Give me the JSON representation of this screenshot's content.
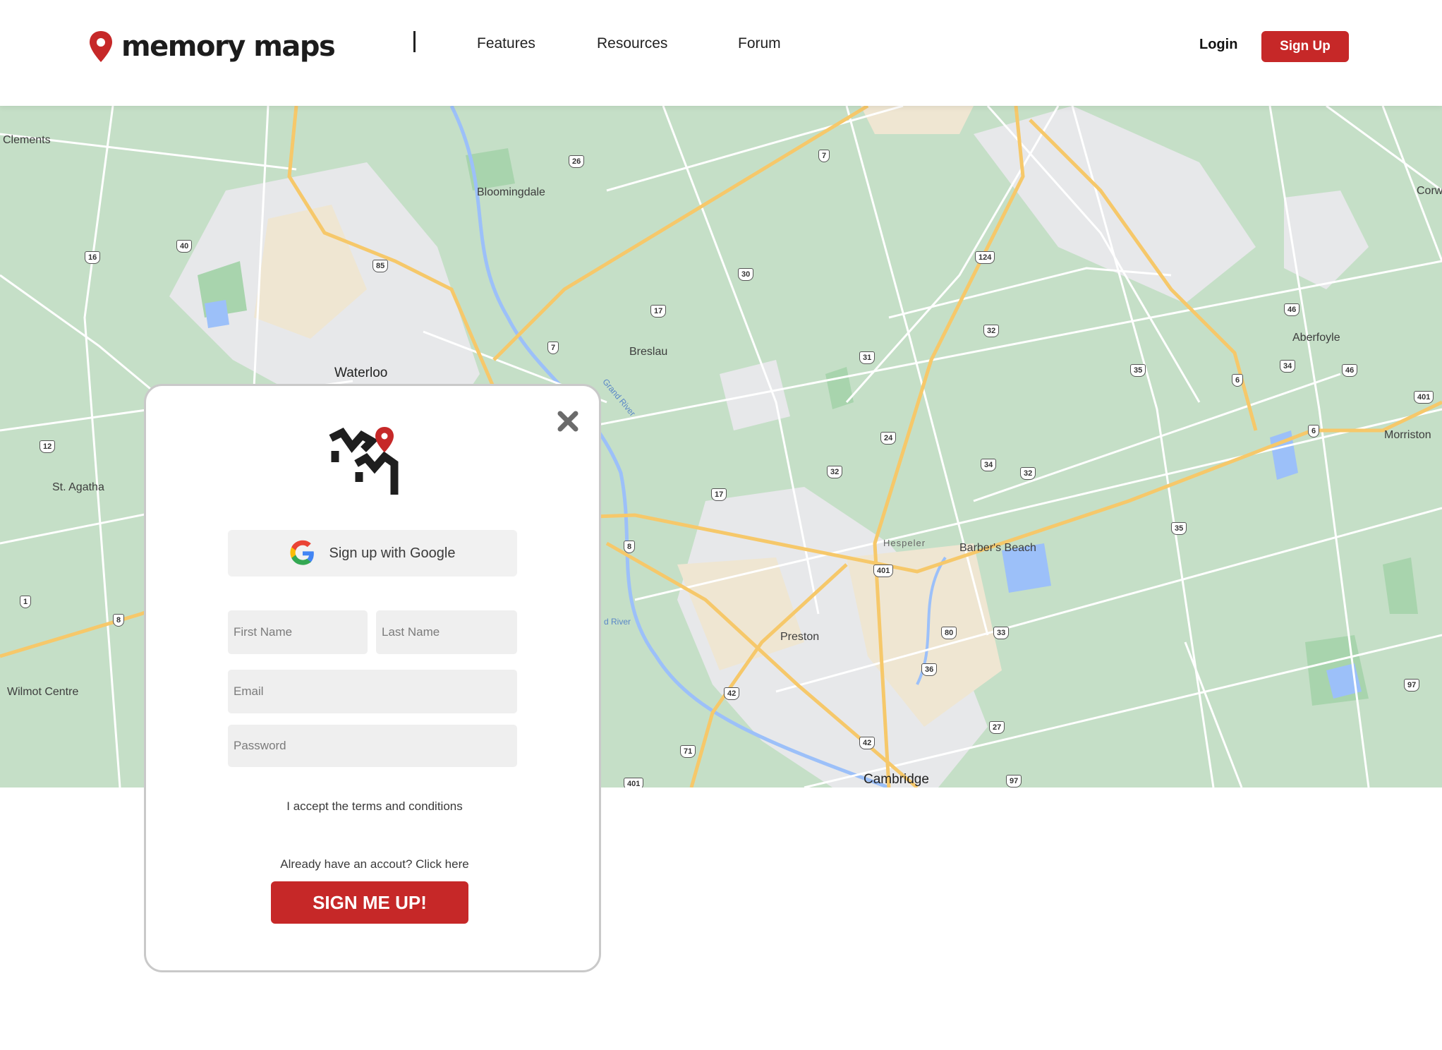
{
  "header": {
    "brand": "memory maps",
    "nav": [
      {
        "label": "Features"
      },
      {
        "label": "Resources"
      },
      {
        "label": "Forum"
      }
    ],
    "login_label": "Login",
    "signup_label": "Sign Up",
    "accent_color": "#c62828"
  },
  "map": {
    "places": [
      "Clements",
      "Bloomingdale",
      "Waterloo",
      "Breslau",
      "Grand River",
      "St. Agatha",
      "Wilmot Centre",
      "Hespeler",
      "Barber's Beach",
      "Preston",
      "Cambridge",
      "Aberfoyle",
      "Morriston",
      "Corw"
    ],
    "highways": [
      "26",
      "7",
      "16",
      "40",
      "85",
      "30",
      "17",
      "124",
      "7",
      "32",
      "46",
      "35",
      "6",
      "34",
      "46",
      "401",
      "31",
      "24",
      "12",
      "6",
      "32",
      "34",
      "32",
      "17",
      "35",
      "8",
      "1",
      "8",
      "401",
      "80",
      "33",
      "42",
      "36",
      "71",
      "42",
      "27",
      "97",
      "401",
      "97"
    ],
    "river_label_2": "d River"
  },
  "modal": {
    "close_icon": "close-icon",
    "google_label": "Sign up with Google",
    "first_name_placeholder": "First Name",
    "last_name_placeholder": "Last Name",
    "email_placeholder": "Email",
    "password_placeholder": "Password",
    "terms_label": "I accept the terms and conditions",
    "already_label": "Already have an accout? Click here",
    "submit_label": "SIGN ME UP!"
  }
}
